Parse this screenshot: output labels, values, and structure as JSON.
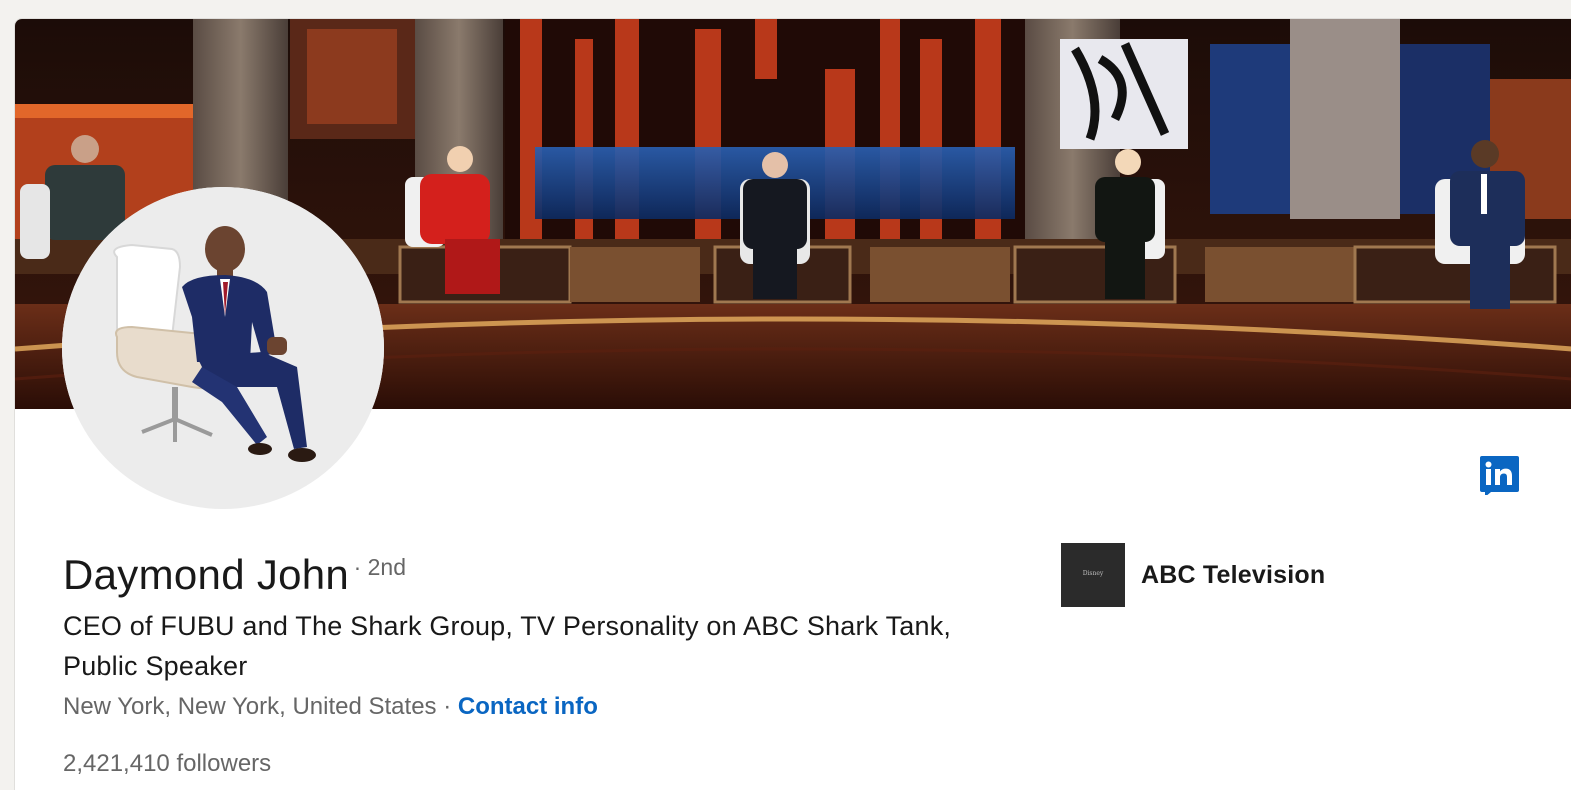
{
  "profile": {
    "name": "Daymond John",
    "degree": "· 2nd",
    "headline": "CEO of FUBU and The Shark Group, TV Personality on ABC Shark Tank, Public Speaker",
    "location": "New York, New York, United States",
    "separator": "·",
    "contact_label": "Contact info",
    "followers_count": "2,421,410",
    "followers_label": "followers"
  },
  "company": {
    "name": "ABC Television",
    "logo_text": "Disney"
  },
  "icons": {
    "linkedin": "linkedin-icon"
  },
  "colors": {
    "link": "#0a66c2",
    "linkedin_blue": "#0a66c2",
    "text_primary": "#191919",
    "text_secondary": "#666666"
  }
}
